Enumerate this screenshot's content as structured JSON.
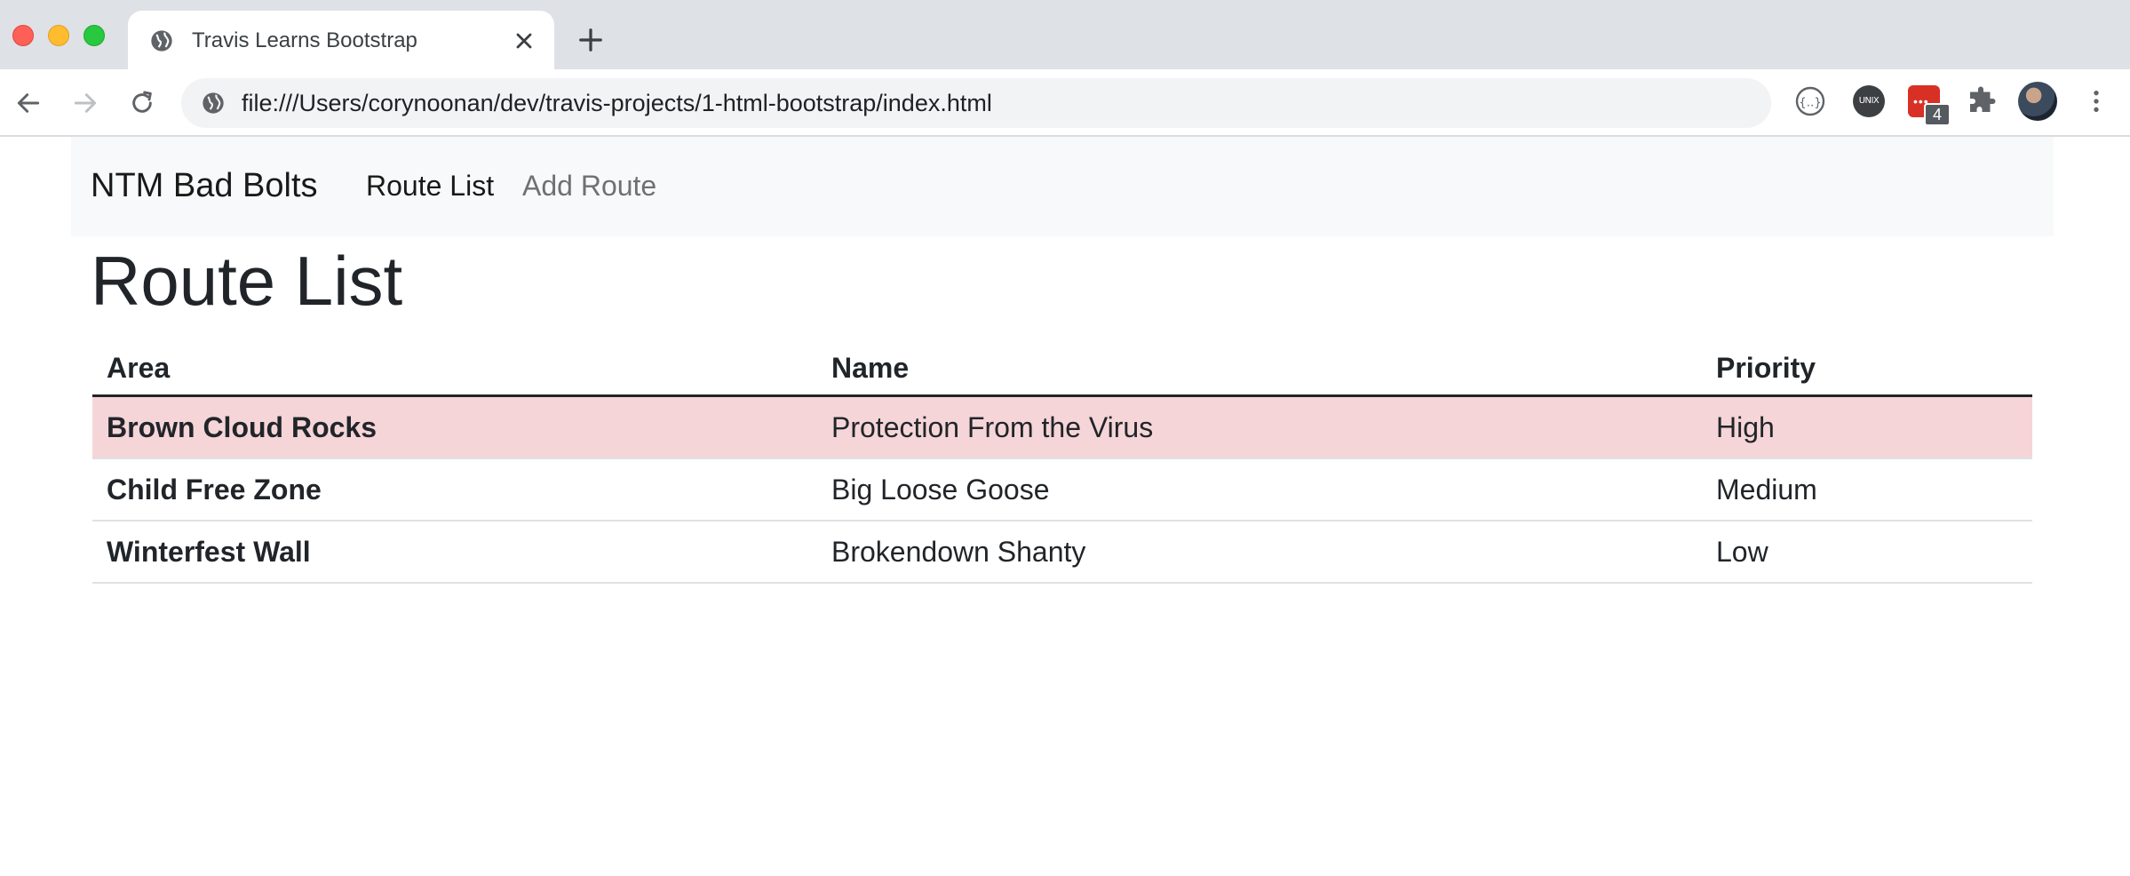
{
  "browser": {
    "tab_title": "Travis Learns Bootstrap",
    "url": "file:///Users/corynoonan/dev/travis-projects/1-html-bootstrap/index.html",
    "extensions": [
      {
        "name": "json-formatter-icon"
      },
      {
        "name": "unix-time-icon",
        "label": "UNIX"
      },
      {
        "name": "todo-extension-icon",
        "badge": "4"
      },
      {
        "name": "puzzle-icon"
      }
    ]
  },
  "navbar": {
    "brand": "NTM Bad Bolts",
    "links": [
      {
        "label": "Route List",
        "active": true
      },
      {
        "label": "Add Route",
        "active": false
      }
    ]
  },
  "page": {
    "title": "Route List"
  },
  "table": {
    "headers": [
      "Area",
      "Name",
      "Priority"
    ],
    "rows": [
      {
        "area": "Brown Cloud Rocks",
        "name": "Protection From the Virus",
        "priority": "High",
        "highlight": "danger"
      },
      {
        "area": "Child Free Zone",
        "name": "Big Loose Goose",
        "priority": "Medium",
        "highlight": ""
      },
      {
        "area": "Winterfest Wall",
        "name": "Brokendown Shanty",
        "priority": "Low",
        "highlight": ""
      }
    ]
  },
  "colors": {
    "tabstrip": "#dee1e6",
    "navbar_bg": "#f8f9fa",
    "danger_row": "#f5d5d8",
    "text": "#212529"
  }
}
